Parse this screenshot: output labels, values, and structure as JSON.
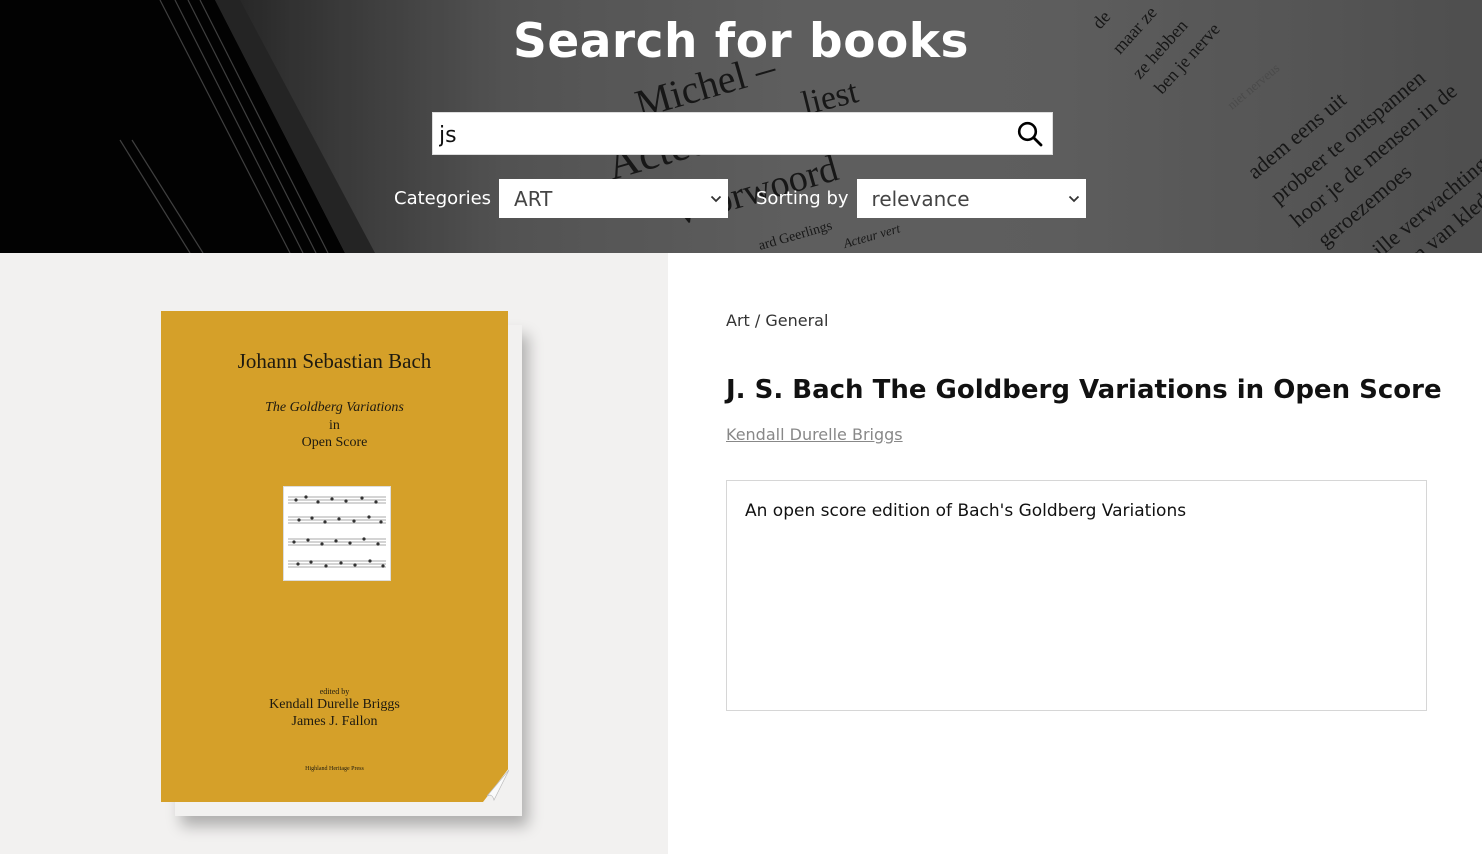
{
  "header": {
    "title": "Search for books",
    "background_words": [
      "Michel –",
      "Acteur",
      "voorwoord",
      "liest",
      "adem eens uit",
      "probeer te ontspannen",
      "hoor je de mensen in de",
      "geroezemoes",
      "ille verwachting",
      "n van klede",
      "maar ze",
      "ze hebben",
      "ben je nerve",
      "niet nerveus",
      "de",
      "ard Geerlings",
      "Acteur vert"
    ]
  },
  "search": {
    "value": "js",
    "placeholder": ""
  },
  "filters": {
    "categories_label": "Categories",
    "categories_value": "ART",
    "sorting_label": "Sorting by",
    "sorting_value": "relevance"
  },
  "book": {
    "breadcrumb": "Art / General",
    "title": "J. S. Bach The Goldberg Variations in Open Score",
    "author": "Kendall Durelle Briggs",
    "description": "An open score edition of Bach's Goldberg Variations",
    "cover": {
      "author": "Johann Sebastian Bach",
      "title_line1": "The Goldberg Variations",
      "title_line2": "in",
      "title_line3": "Open Score",
      "edited_by": "edited by",
      "editor1": "Kendall Durelle Briggs",
      "editor2": "James J. Fallon",
      "publisher": "Highland Heritage Press"
    }
  },
  "colors": {
    "cover": "#d5a029",
    "left_panel": "#f2f1f0",
    "hero_text": "#ffffff",
    "author_link": "#888888"
  }
}
